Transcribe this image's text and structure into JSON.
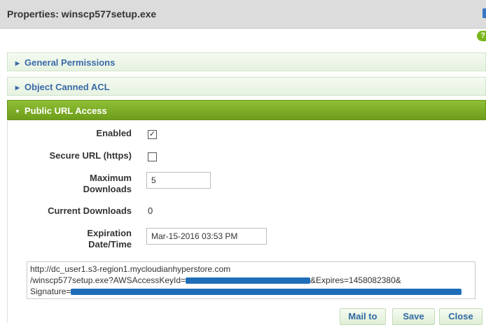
{
  "window": {
    "title": "Properties: winscp577setup.exe"
  },
  "help": {
    "glyph": "?"
  },
  "sections": [
    {
      "label": "General Permissions",
      "state": "collapsed"
    },
    {
      "label": "Object Canned ACL",
      "state": "collapsed"
    },
    {
      "label": "Public URL Access",
      "state": "expanded"
    }
  ],
  "public_url": {
    "enabled_label": "Enabled",
    "enabled_checked": true,
    "secure_label": "Secure URL (https)",
    "secure_checked": false,
    "max_downloads_label_1": "Maximum",
    "max_downloads_label_2": "Downloads",
    "max_downloads_value": "5",
    "current_downloads_label": "Current Downloads",
    "current_downloads_value": "0",
    "expiration_label_1": "Expiration",
    "expiration_label_2": "Date/Time",
    "expiration_value": "Mar-15-2016 03:53 PM",
    "url_line_1": "http://dc_user1.s3-region1.mycloudianhyperstore.com",
    "url_line_2_prefix": "/winscp577setup.exe?AWSAccessKeyId=",
    "url_line_2_suffix": "&Expires=1458082380&",
    "url_line_3_prefix": "Signature="
  },
  "buttons": {
    "mail": "Mail to",
    "save": "Save",
    "close": "Close"
  },
  "colors": {
    "accent_green": "#7fae2a",
    "link_blue": "#2f6aa3",
    "redaction": "#1f6fb8"
  }
}
